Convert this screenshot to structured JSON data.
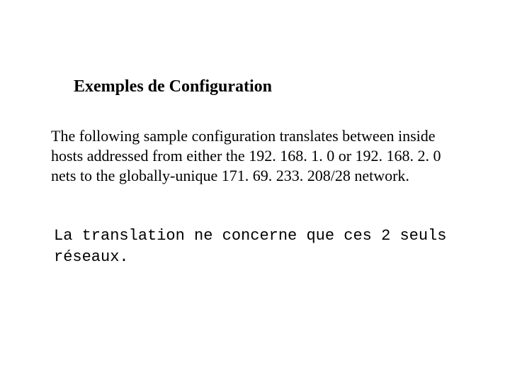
{
  "title": "Exemples de Configuration",
  "body": "The following sample configuration translates between inside hosts addressed from either the 192. 168. 1. 0 or 192. 168. 2. 0 nets to the globally-unique 171. 69. 233. 208/28 network.",
  "mono": "La translation ne concerne que ces 2 seuls réseaux."
}
